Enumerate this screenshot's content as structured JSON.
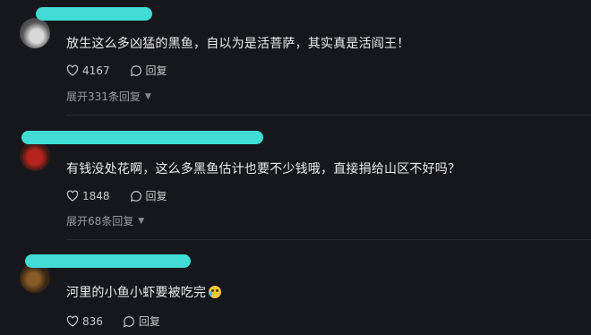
{
  "comments": [
    {
      "text": "放生这么多凶猛的黑鱼，自以为是活菩萨，其实真是活阎王！",
      "likes": "4167",
      "reply_label": "回复",
      "expand_label": "展开331条回复"
    },
    {
      "text": "有钱没处花啊，这么多黑鱼估计也要不少钱哦，直接捐给山区不好吗？",
      "likes": "1848",
      "reply_label": "回复",
      "expand_label": "展开68条回复"
    },
    {
      "text": "河里的小鱼小虾要被吃完",
      "emoji": "crying-emoji",
      "likes": "836",
      "reply_label": "回复"
    }
  ],
  "colors": {
    "background": "#16171c",
    "username_redaction": "#40dcd5",
    "text": "#ececee",
    "muted": "#9a9aa1"
  }
}
